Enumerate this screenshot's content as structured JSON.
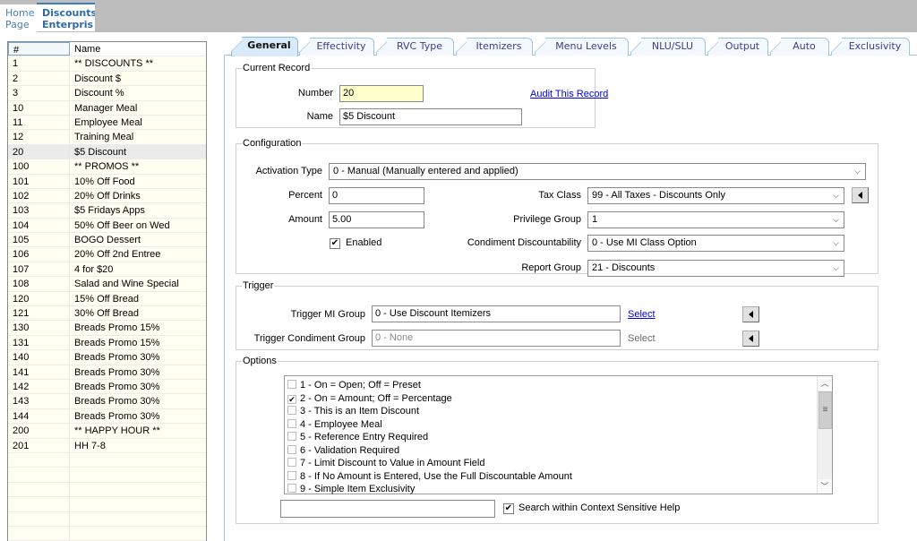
{
  "top_tabs": [
    {
      "label": "Home\nPage"
    },
    {
      "label": "Discounts\nEnterpris"
    }
  ],
  "grid": {
    "columns": [
      "#",
      "Name"
    ],
    "selected_number": "20",
    "rows": [
      {
        "num": "1",
        "name": "** DISCOUNTS **"
      },
      {
        "num": "2",
        "name": "Discount $"
      },
      {
        "num": "3",
        "name": "Discount %"
      },
      {
        "num": "10",
        "name": "Manager Meal"
      },
      {
        "num": "11",
        "name": "Employee Meal"
      },
      {
        "num": "12",
        "name": "Training Meal"
      },
      {
        "num": "20",
        "name": "$5 Discount"
      },
      {
        "num": "100",
        "name": "** PROMOS **"
      },
      {
        "num": "101",
        "name": "10% Off Food"
      },
      {
        "num": "102",
        "name": "20% Off Drinks"
      },
      {
        "num": "103",
        "name": "$5 Fridays Apps"
      },
      {
        "num": "104",
        "name": "50% Off Beer on Wed"
      },
      {
        "num": "105",
        "name": "BOGO Dessert"
      },
      {
        "num": "106",
        "name": "20% Off 2nd Entree"
      },
      {
        "num": "107",
        "name": "4 for $20"
      },
      {
        "num": "108",
        "name": "Salad and Wine Special"
      },
      {
        "num": "120",
        "name": "15% Off Bread"
      },
      {
        "num": "121",
        "name": "30% Off Bread"
      },
      {
        "num": "130",
        "name": "Breads Promo 15%"
      },
      {
        "num": "131",
        "name": "Breads Promo 15%"
      },
      {
        "num": "140",
        "name": "Breads Promo 30%"
      },
      {
        "num": "141",
        "name": "Breads Promo 30%"
      },
      {
        "num": "142",
        "name": "Breads Promo 30%"
      },
      {
        "num": "143",
        "name": "Breads Promo 30%"
      },
      {
        "num": "144",
        "name": "Breads Promo 30%"
      },
      {
        "num": "200",
        "name": "** HAPPY HOUR **"
      },
      {
        "num": "201",
        "name": "HH 7-8"
      }
    ]
  },
  "tabs": [
    {
      "label": "General",
      "active": true
    },
    {
      "label": "Effectivity"
    },
    {
      "label": "RVC Type"
    },
    {
      "label": "Itemizers"
    },
    {
      "label": "Menu Levels"
    },
    {
      "label": "NLU/SLU"
    },
    {
      "label": "Output"
    },
    {
      "label": "Auto"
    },
    {
      "label": "Exclusivity"
    }
  ],
  "current_record": {
    "legend": "Current Record",
    "number_label": "Number",
    "number_value": "20",
    "name_label": "Name",
    "name_value": "$5 Discount",
    "audit_link": "Audit This Record"
  },
  "configuration": {
    "legend": "Configuration",
    "activation_type_label": "Activation Type",
    "activation_type_value": "0 - Manual (Manually entered and applied)",
    "percent_label": "Percent",
    "percent_value": "0",
    "amount_label": "Amount",
    "amount_value": "5.00",
    "enabled_label": "Enabled",
    "enabled_checked": true,
    "tax_class_label": "Tax Class",
    "tax_class_value": "99 - All Taxes - Discounts Only",
    "privilege_group_label": "Privilege Group",
    "privilege_group_value": "1",
    "condiment_label": "Condiment Discountability",
    "condiment_value": "0 - Use MI Class Option",
    "report_group_label": "Report Group",
    "report_group_value": "21 - Discounts"
  },
  "trigger": {
    "legend": "Trigger",
    "mi_group_label": "Trigger MI Group",
    "mi_group_value": "0 - Use Discount Itemizers",
    "mi_group_select": "Select",
    "condiment_group_label": "Trigger Condiment Group",
    "condiment_group_value": "0 - None",
    "condiment_group_select": "Select"
  },
  "options": {
    "legend": "Options",
    "items": [
      {
        "label": "1 - On = Open; Off = Preset",
        "checked": false
      },
      {
        "label": "2 - On = Amount; Off = Percentage",
        "checked": true
      },
      {
        "label": "3 - This is an Item Discount",
        "checked": false
      },
      {
        "label": "4 - Employee Meal",
        "checked": false
      },
      {
        "label": "5 - Reference Entry Required",
        "checked": false
      },
      {
        "label": "6 - Validation Required",
        "checked": false
      },
      {
        "label": "7 - Limit Discount to Value in Amount Field",
        "checked": false
      },
      {
        "label": "8 - If No Amount is Entered, Use the Full Discountable Amount",
        "checked": false
      },
      {
        "label": "9 - Simple Item Exclusivity",
        "checked": false
      }
    ],
    "search_value": "",
    "search_help_label": "Search within Context Sensitive Help",
    "search_help_checked": true
  },
  "glyphs": {
    "check": "✔",
    "chevron_down": "⌵",
    "scroll_up": "︿",
    "scroll_down": "﹀",
    "grip": "≡"
  }
}
